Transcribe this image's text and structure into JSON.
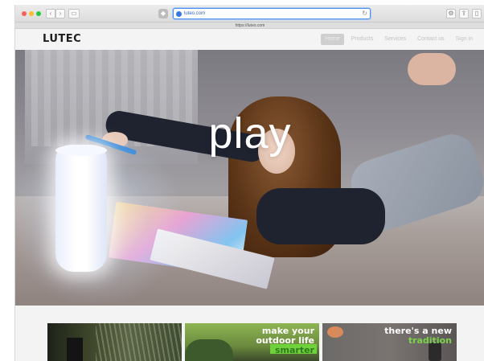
{
  "browser": {
    "url": "luteo.com",
    "tab_title": "https://luteo.com",
    "nav_back": "‹",
    "nav_forward": "›",
    "sidebar_toggle": "▭",
    "reload": "↻",
    "toolbar_right": [
      "⚙",
      "⇪",
      "▯"
    ]
  },
  "site": {
    "logo": "LUTEC",
    "nav": [
      {
        "label": "Home",
        "active": true
      },
      {
        "label": "Products",
        "active": false
      },
      {
        "label": "Services",
        "active": false
      },
      {
        "label": "Contact us",
        "active": false
      },
      {
        "label": "Sign in",
        "active": false
      }
    ]
  },
  "hero": {
    "title": "play"
  },
  "cards": [
    {
      "lines": []
    },
    {
      "lines": [
        "make your",
        "outdoor life",
        "smarter"
      ]
    },
    {
      "lines": [
        "there's a new",
        "tradition"
      ]
    }
  ],
  "colors": {
    "accent_green": "#7bd34a",
    "url_border": "#4b8ff0"
  }
}
